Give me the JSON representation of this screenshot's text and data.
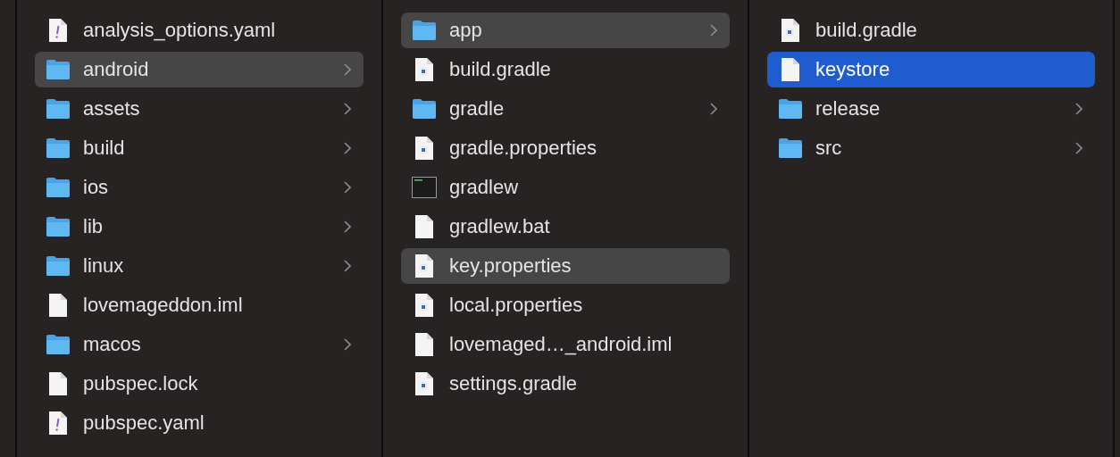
{
  "columns": [
    {
      "items": [
        {
          "name": "analysis_options.yaml",
          "kind": "yaml",
          "selected": false,
          "highlighted": false
        },
        {
          "name": "android",
          "kind": "folder",
          "selected": false,
          "highlighted": true
        },
        {
          "name": "assets",
          "kind": "folder",
          "selected": false,
          "highlighted": false
        },
        {
          "name": "build",
          "kind": "folder",
          "selected": false,
          "highlighted": false
        },
        {
          "name": "ios",
          "kind": "folder",
          "selected": false,
          "highlighted": false
        },
        {
          "name": "lib",
          "kind": "folder",
          "selected": false,
          "highlighted": false
        },
        {
          "name": "linux",
          "kind": "folder",
          "selected": false,
          "highlighted": false
        },
        {
          "name": "lovemageddon.iml",
          "kind": "document",
          "selected": false,
          "highlighted": false
        },
        {
          "name": "macos",
          "kind": "folder",
          "selected": false,
          "highlighted": false
        },
        {
          "name": "pubspec.lock",
          "kind": "document",
          "selected": false,
          "highlighted": false
        },
        {
          "name": "pubspec.yaml",
          "kind": "yaml",
          "selected": false,
          "highlighted": false
        }
      ]
    },
    {
      "items": [
        {
          "name": "app",
          "kind": "folder",
          "selected": false,
          "highlighted": true
        },
        {
          "name": "build.gradle",
          "kind": "gradle",
          "selected": false,
          "highlighted": false
        },
        {
          "name": "gradle",
          "kind": "folder",
          "selected": false,
          "highlighted": false
        },
        {
          "name": "gradle.properties",
          "kind": "gradle",
          "selected": false,
          "highlighted": false
        },
        {
          "name": "gradlew",
          "kind": "executable",
          "selected": false,
          "highlighted": false
        },
        {
          "name": "gradlew.bat",
          "kind": "document",
          "selected": false,
          "highlighted": false
        },
        {
          "name": "key.properties",
          "kind": "gradle",
          "selected": false,
          "highlighted": true
        },
        {
          "name": "local.properties",
          "kind": "gradle",
          "selected": false,
          "highlighted": false
        },
        {
          "name": "lovemaged…_android.iml",
          "kind": "document",
          "selected": false,
          "highlighted": false
        },
        {
          "name": "settings.gradle",
          "kind": "gradle",
          "selected": false,
          "highlighted": false
        }
      ]
    },
    {
      "items": [
        {
          "name": "build.gradle",
          "kind": "gradle",
          "selected": false,
          "highlighted": false
        },
        {
          "name": "keystore",
          "kind": "document",
          "selected": true,
          "highlighted": false
        },
        {
          "name": "release",
          "kind": "folder",
          "selected": false,
          "highlighted": false
        },
        {
          "name": "src",
          "kind": "folder",
          "selected": false,
          "highlighted": false
        }
      ]
    }
  ]
}
